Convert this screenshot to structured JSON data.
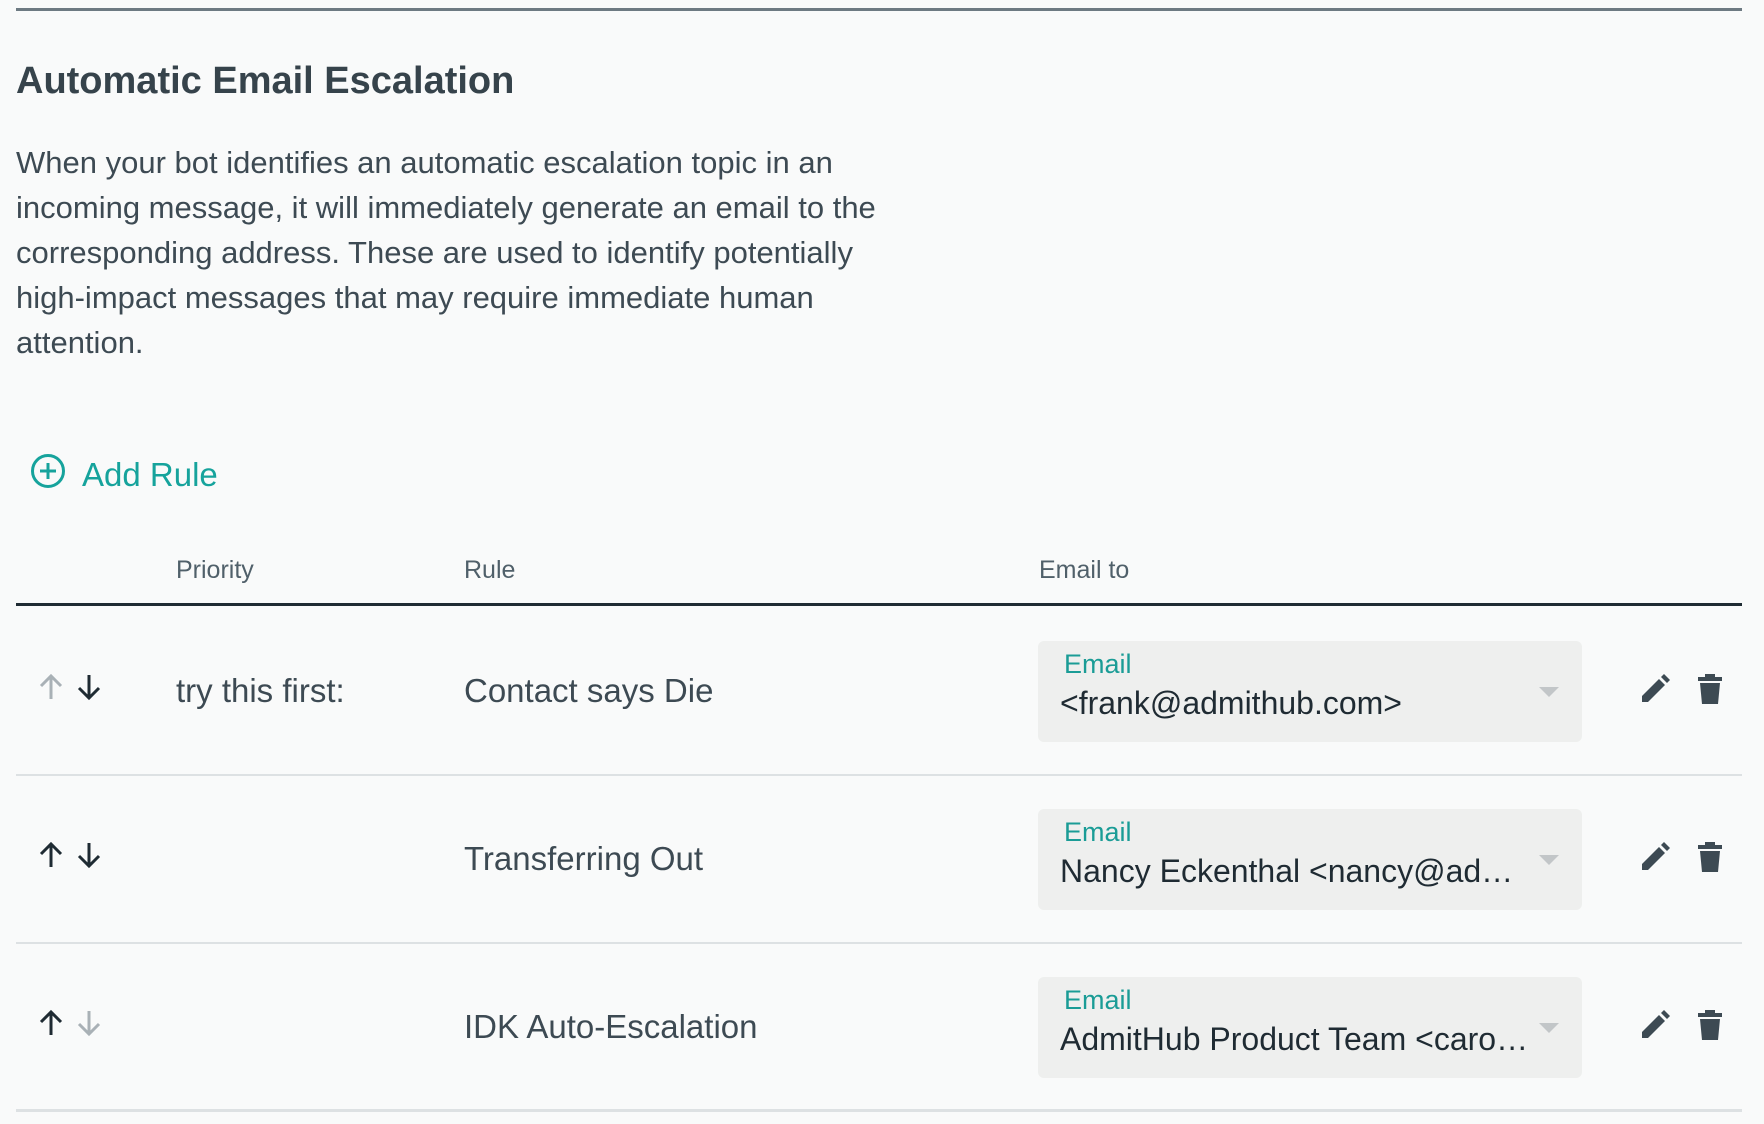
{
  "section": {
    "title": "Automatic Email Escalation",
    "description": "When your bot identifies an automatic escalation topic in an incoming message, it will immediately generate an email to the corresponding address. These are used to identify potentially high-impact messages that may require immediate human attention."
  },
  "add_rule": {
    "label": "Add Rule",
    "icon": "plus-circle-icon"
  },
  "table": {
    "headers": {
      "priority": "Priority",
      "rule": "Rule",
      "email_to": "Email to"
    },
    "rows": [
      {
        "priority_label": "try this first:",
        "rule": "Contact says Die",
        "email_field_label": "Email",
        "email_value": "<frank@admithub.com>",
        "up_enabled": false,
        "down_enabled": true
      },
      {
        "priority_label": "",
        "rule": "Transferring Out",
        "email_field_label": "Email",
        "email_value": "Nancy Eckenthal <nancy@admi…",
        "up_enabled": true,
        "down_enabled": true
      },
      {
        "priority_label": "",
        "rule": "IDK Auto-Escalation",
        "email_field_label": "Email",
        "email_value": "AdmitHub Product Team <carol…",
        "up_enabled": true,
        "down_enabled": false
      }
    ]
  },
  "colors": {
    "accent": "#16a39c",
    "text": "#3d4a53",
    "arrow_enabled": "#1f2b33",
    "arrow_disabled": "#a9b1b6",
    "icon": "#3d4a53"
  }
}
